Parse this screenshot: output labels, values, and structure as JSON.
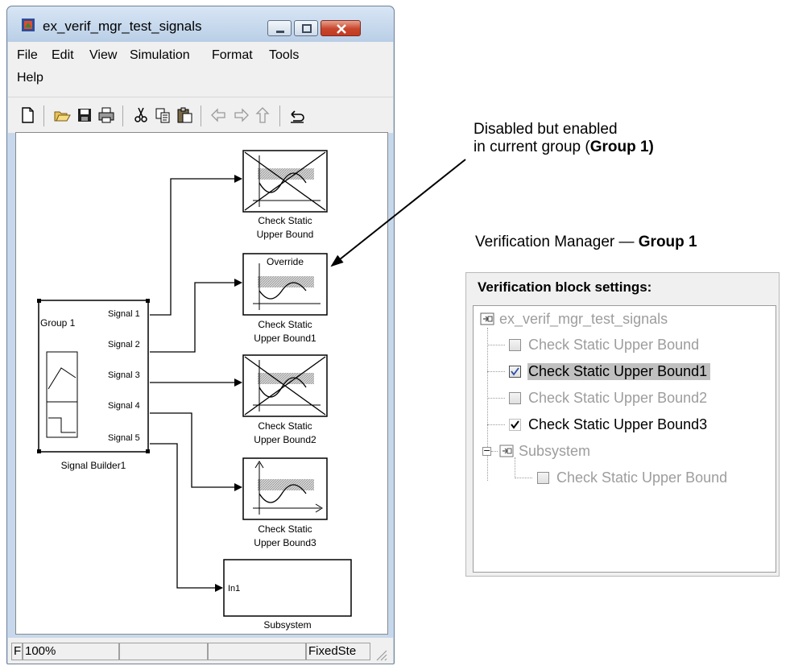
{
  "window": {
    "title": "ex_verif_mgr_test_signals",
    "menu": [
      "File",
      "Edit",
      "View",
      "Simulation",
      "Format",
      "Tools",
      "Help"
    ]
  },
  "diagram": {
    "signal_builder": {
      "group": "Group 1",
      "signals": [
        "Signal 1",
        "Signal 2",
        "Signal 3",
        "Signal 4",
        "Signal 5"
      ],
      "name": "Signal Builder1"
    },
    "blocks": [
      {
        "line1": "Check Static",
        "line2": "Upper Bound",
        "style": "disabled"
      },
      {
        "line1": "Check Static",
        "line2": "Upper Bound1",
        "style": "override",
        "override_label": "Override"
      },
      {
        "line1": "Check Static",
        "line2": "Upper Bound2",
        "style": "disabled"
      },
      {
        "line1": "Check Static",
        "line2": "Upper Bound3",
        "style": "enabled"
      }
    ],
    "subsystem": {
      "port": "In1",
      "name": "Subsystem"
    }
  },
  "statusbar": {
    "cell0": "F",
    "zoom": "100%",
    "cell2": "",
    "cell3": "",
    "solver": "FixedSte"
  },
  "annotations": {
    "note_line1": "Disabled but enabled",
    "note_line2_prefix": "in current group (",
    "note_line2_bold": "Group 1)",
    "panel_caption_prefix": "Verification Manager — ",
    "panel_caption_bold": "Group 1"
  },
  "verification_panel": {
    "header": "Verification block settings:",
    "root": "ex_verif_mgr_test_signals",
    "items": [
      {
        "label": "Check Static  Upper Bound",
        "checked": false,
        "enabled": false
      },
      {
        "label": "Check Static  Upper Bound1",
        "checked": true,
        "enabled": true,
        "selected": true
      },
      {
        "label": "Check Static  Upper Bound2",
        "checked": false,
        "enabled": false
      },
      {
        "label": "Check Static  Upper Bound3",
        "checked": true,
        "enabled": true
      }
    ],
    "subsystem": {
      "label": "Subsystem",
      "expander": "−",
      "items": [
        {
          "label": "Check Static  Upper Bound",
          "checked": false,
          "enabled": false
        }
      ]
    }
  },
  "colors": {
    "window_frame": "#c7d8ec",
    "selection": "#c0c0c0",
    "disabled_text": "#9d9d9d",
    "check_blue": "#2b4ea6"
  }
}
